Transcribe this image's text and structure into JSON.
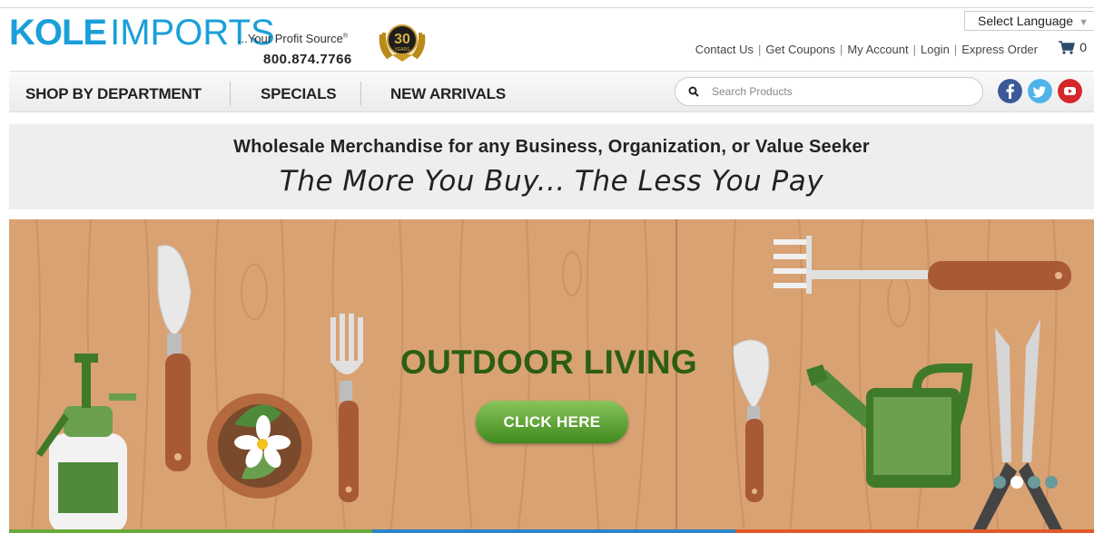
{
  "header": {
    "logo_primary": "KOLE",
    "logo_secondary": "IMPORTS",
    "tagline": "...Your Profit Source",
    "phone": "800.874.7766",
    "badge_years": "30",
    "badge_text": "YEARS",
    "language_select": "Select Language",
    "links": [
      "Contact Us",
      "Get Coupons",
      "My Account",
      "Login",
      "Express Order"
    ],
    "cart_count": "0"
  },
  "nav": {
    "items": [
      "SHOP BY DEPARTMENT",
      "SPECIALS",
      "NEW ARRIVALS"
    ],
    "search_placeholder": "Search Products",
    "social": [
      "facebook-icon",
      "twitter-icon",
      "youtube-icon"
    ]
  },
  "promo": {
    "headline": "Wholesale Merchandise for any Business, Organization, or Value Seeker",
    "slogan": "The More You Buy... The Less You Pay"
  },
  "hero": {
    "title": "OUTDOOR LIVING",
    "button": "CLICK HERE",
    "slide_count": 4,
    "active_slide": 2
  },
  "colors": {
    "brand_blue": "#1a9fd9",
    "hero_title": "#2b5e14",
    "hero_bg": "#d9a273",
    "bar_colors": [
      "#6aaa3a",
      "#2a86c8",
      "#e05a2a"
    ]
  }
}
